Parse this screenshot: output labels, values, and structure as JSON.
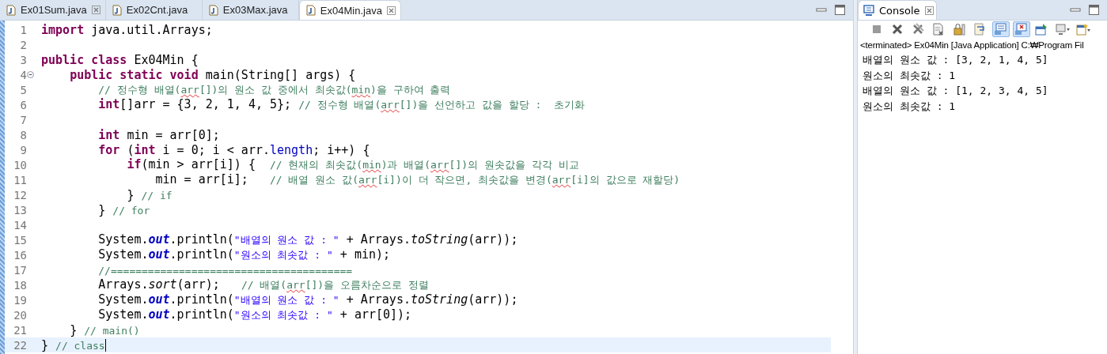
{
  "editor": {
    "tabs": [
      {
        "label": "Ex01Sum.java",
        "selected": false,
        "closable": true
      },
      {
        "label": "Ex02Cnt.java",
        "selected": false,
        "closable": false
      },
      {
        "label": "Ex03Max.java",
        "selected": false,
        "closable": false
      },
      {
        "label": "Ex04Min.java",
        "selected": true,
        "closable": true
      }
    ],
    "lines": [
      {
        "number": "1",
        "current": false,
        "collapsible": false,
        "tokens": [
          {
            "kind": "keyword",
            "text": "import"
          },
          {
            "kind": "plain",
            "text": " java.util.Arrays;"
          }
        ]
      },
      {
        "number": "2",
        "current": false,
        "collapsible": false
      },
      {
        "number": "3",
        "current": false,
        "collapsible": false,
        "tokens": [
          {
            "kind": "keyword",
            "text": "public"
          },
          {
            "kind": "keyword",
            "text": " class"
          },
          {
            "kind": "plain",
            "text": " Ex04Min {"
          }
        ]
      },
      {
        "number": "4",
        "current": false,
        "collapsible": true,
        "tokens": [
          {
            "kind": "keyword",
            "text": "    public"
          },
          {
            "kind": "keyword",
            "text": " static"
          },
          {
            "kind": "keyword",
            "text": " void"
          },
          {
            "kind": "plain",
            "text": " main(String[] args) {"
          }
        ]
      },
      {
        "number": "5",
        "current": false,
        "collapsible": false,
        "tokens": [
          {
            "kind": "comment",
            "text": "        // 정수형 배열("
          },
          {
            "kind": "misspelled",
            "text": "arr"
          },
          {
            "kind": "comment",
            "text": "[])의 원소 값 중에서 최솟값("
          },
          {
            "kind": "misspelled",
            "text": "min"
          },
          {
            "kind": "comment",
            "text": ")을 구하여 출력"
          }
        ]
      },
      {
        "number": "6",
        "current": false,
        "collapsible": false,
        "tokens": [
          {
            "kind": "keyword",
            "text": "        int"
          },
          {
            "kind": "plain",
            "text": "[]arr = {3, 2, 1, 4, 5}; "
          },
          {
            "kind": "comment",
            "text": "// 정수형 배열("
          },
          {
            "kind": "misspelled",
            "text": "arr"
          },
          {
            "kind": "comment",
            "text": "[])을 선언하고 값을 할당 :  초기화"
          }
        ]
      },
      {
        "number": "7",
        "current": false,
        "collapsible": false
      },
      {
        "number": "8",
        "current": false,
        "collapsible": false,
        "tokens": [
          {
            "kind": "keyword",
            "text": "        int"
          },
          {
            "kind": "plain",
            "text": " min = arr[0];"
          }
        ]
      },
      {
        "number": "9",
        "current": false,
        "collapsible": false,
        "tokens": [
          {
            "kind": "keyword",
            "text": "        for"
          },
          {
            "kind": "plain",
            "text": " ("
          },
          {
            "kind": "keyword",
            "text": "int"
          },
          {
            "kind": "plain",
            "text": " i = 0; i < arr."
          },
          {
            "kind": "field",
            "text": "length"
          },
          {
            "kind": "plain",
            "text": "; i++) {"
          }
        ]
      },
      {
        "number": "10",
        "current": false,
        "collapsible": false,
        "tokens": [
          {
            "kind": "keyword",
            "text": "            if"
          },
          {
            "kind": "plain",
            "text": "(min > arr[i]) {  "
          },
          {
            "kind": "comment",
            "text": "// 현재의 최솟값("
          },
          {
            "kind": "misspelled",
            "text": "min"
          },
          {
            "kind": "comment",
            "text": ")과 배열("
          },
          {
            "kind": "misspelled",
            "text": "arr"
          },
          {
            "kind": "comment",
            "text": "[])의 원솟값을 각각 비교"
          }
        ]
      },
      {
        "number": "11",
        "current": false,
        "collapsible": false,
        "tokens": [
          {
            "kind": "plain",
            "text": "                min = arr[i];   "
          },
          {
            "kind": "comment",
            "text": "// 배열 원소 값("
          },
          {
            "kind": "misspelled",
            "text": "arr"
          },
          {
            "kind": "comment",
            "text": "[i])이 더 작으면, 최솟값을 변경("
          },
          {
            "kind": "misspelled",
            "text": "arr"
          },
          {
            "kind": "comment",
            "text": "[i]의 값으로 재할당)"
          }
        ]
      },
      {
        "number": "12",
        "current": false,
        "collapsible": false,
        "tokens": [
          {
            "kind": "plain",
            "text": "            } "
          },
          {
            "kind": "comment",
            "text": "// if"
          }
        ]
      },
      {
        "number": "13",
        "current": false,
        "collapsible": false,
        "tokens": [
          {
            "kind": "plain",
            "text": "        } "
          },
          {
            "kind": "comment",
            "text": "// for"
          }
        ]
      },
      {
        "number": "14",
        "current": false,
        "collapsible": false
      },
      {
        "number": "15",
        "current": false,
        "collapsible": false,
        "tokens": [
          {
            "kind": "plain",
            "text": "        System."
          },
          {
            "kind": "static-field",
            "text": "out"
          },
          {
            "kind": "plain",
            "text": ".println("
          },
          {
            "kind": "string",
            "text": "\"배열의 원소 값 : \""
          },
          {
            "kind": "plain",
            "text": " + Arrays."
          },
          {
            "kind": "static-method",
            "text": "toString"
          },
          {
            "kind": "plain",
            "text": "(arr));"
          }
        ]
      },
      {
        "number": "16",
        "current": false,
        "collapsible": false,
        "tokens": [
          {
            "kind": "plain",
            "text": "        System."
          },
          {
            "kind": "static-field",
            "text": "out"
          },
          {
            "kind": "plain",
            "text": ".println("
          },
          {
            "kind": "string",
            "text": "\"원소의 최솟값 : \""
          },
          {
            "kind": "plain",
            "text": " + min);"
          }
        ]
      },
      {
        "number": "17",
        "current": false,
        "collapsible": false,
        "tokens": [
          {
            "kind": "comment",
            "text": "        //======================================="
          }
        ]
      },
      {
        "number": "18",
        "current": false,
        "collapsible": false,
        "tokens": [
          {
            "kind": "plain",
            "text": "        Arrays."
          },
          {
            "kind": "static-method",
            "text": "sort"
          },
          {
            "kind": "plain",
            "text": "(arr);   "
          },
          {
            "kind": "comment",
            "text": "// 배열("
          },
          {
            "kind": "misspelled",
            "text": "arr"
          },
          {
            "kind": "comment",
            "text": "[])을 오름차순으로 정렬"
          }
        ]
      },
      {
        "number": "19",
        "current": false,
        "collapsible": false,
        "tokens": [
          {
            "kind": "plain",
            "text": "        System."
          },
          {
            "kind": "static-field",
            "text": "out"
          },
          {
            "kind": "plain",
            "text": ".println("
          },
          {
            "kind": "string",
            "text": "\"배열의 원소 값 : \""
          },
          {
            "kind": "plain",
            "text": " + Arrays."
          },
          {
            "kind": "static-method",
            "text": "toString"
          },
          {
            "kind": "plain",
            "text": "(arr));"
          }
        ]
      },
      {
        "number": "20",
        "current": false,
        "collapsible": false,
        "tokens": [
          {
            "kind": "plain",
            "text": "        System."
          },
          {
            "kind": "static-field",
            "text": "out"
          },
          {
            "kind": "plain",
            "text": ".println("
          },
          {
            "kind": "string",
            "text": "\"원소의 최솟값 : \""
          },
          {
            "kind": "plain",
            "text": " + arr[0]);"
          }
        ]
      },
      {
        "number": "21",
        "current": false,
        "collapsible": false,
        "tokens": [
          {
            "kind": "plain",
            "text": "    } "
          },
          {
            "kind": "comment",
            "text": "// main()"
          }
        ]
      },
      {
        "number": "22",
        "current": true,
        "collapsible": false,
        "tokens": [
          {
            "kind": "plain",
            "text": "} "
          },
          {
            "kind": "comment",
            "text": "// class"
          }
        ]
      }
    ]
  },
  "console": {
    "tab": {
      "label": "Console",
      "selected": true
    },
    "toolbar": [
      {
        "kind": "stop",
        "selected": false
      },
      {
        "kind": "remove",
        "selected": false
      },
      {
        "kind": "remove-all",
        "selected": false
      },
      {
        "kind": "clear",
        "selected": false
      },
      {
        "kind": "lock",
        "selected": false
      },
      {
        "kind": "wrap",
        "selected": false
      },
      {
        "kind": "stdout",
        "selected": true
      },
      {
        "kind": "stderr",
        "selected": true
      },
      {
        "kind": "pin",
        "selected": false
      },
      {
        "kind": "display",
        "selected": false
      },
      {
        "kind": "open",
        "selected": false
      }
    ],
    "status": "<terminated> Ex04Min [Java Application] C:₩Program Fil",
    "output": [
      "배열의 원소 값 : [3, 2, 1, 4, 5]",
      "원소의 최솟값 : 1",
      "배열의 원소 값 : [1, 2, 3, 4, 5]",
      "원소의 최솟값 : 1"
    ]
  }
}
